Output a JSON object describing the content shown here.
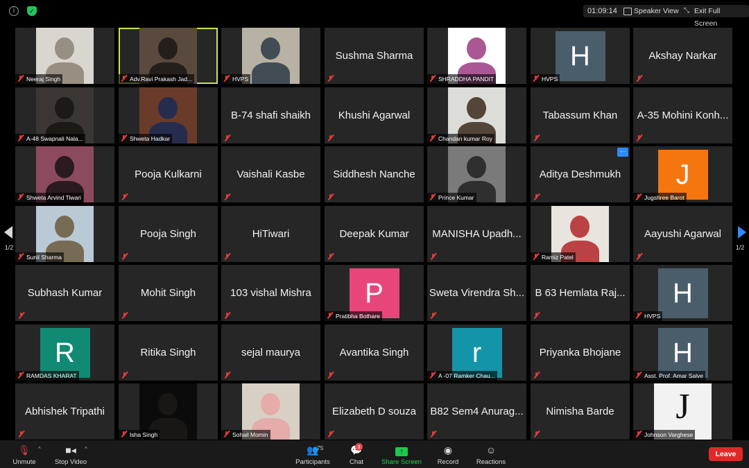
{
  "top": {
    "timer": "01:09:14",
    "speaker_view": "Speaker View",
    "exit_full_screen": "Exit Full Screen"
  },
  "pages": {
    "current": "1/2"
  },
  "tiles": [
    {
      "type": "photo",
      "label": "Neeraj Singh",
      "bg": "#d9d6d0",
      "fg": "#8c8375"
    },
    {
      "type": "photo",
      "label": "Adv.Ravi Prakash Jad...",
      "bg": "#5a4a3e",
      "fg": "#1c1816",
      "active": true
    },
    {
      "type": "photo",
      "label": "HVPS",
      "bg": "#b7b2a4",
      "fg": "#2d3a48"
    },
    {
      "type": "name",
      "name": "Sushma Sharma"
    },
    {
      "type": "photo",
      "label": "SHRADDHA PANDIT",
      "bg": "#ffffff",
      "fg": "#9c3a83"
    },
    {
      "type": "avatar",
      "label": "HVPS",
      "letter": "H",
      "color": "#4a5d6b"
    },
    {
      "type": "name",
      "name": "Akshay Narkar"
    },
    {
      "type": "photo",
      "label": "A-48 Swapnali Nala...",
      "bg": "#3b3633",
      "fg": "#191512"
    },
    {
      "type": "photo",
      "label": "Shweta Hadkar",
      "bg": "#6b3b2a",
      "fg": "#1a2a54"
    },
    {
      "type": "name",
      "name": "B-74 shafi shaikh"
    },
    {
      "type": "name",
      "name": "Khushi Agarwal"
    },
    {
      "type": "photo",
      "label": "Chandan kumar Roy",
      "bg": "#dcdcd8",
      "fg": "#3c2a20"
    },
    {
      "type": "name",
      "name": "Tabassum Khan"
    },
    {
      "type": "name",
      "name": "A-35 Mohini Konh..."
    },
    {
      "type": "photo",
      "label": "Shweta Arvind  Tiwari",
      "bg": "#8b4a5e",
      "fg": "#1a1215"
    },
    {
      "type": "name",
      "name": "Pooja Kulkarni"
    },
    {
      "type": "name",
      "name": "Vaishali Kasbe"
    },
    {
      "type": "name",
      "name": "Siddhesh Nanche"
    },
    {
      "type": "photo",
      "label": "Prince Kumar",
      "bg": "#7a7a7a",
      "fg": "#222222"
    },
    {
      "type": "name",
      "name": "Aditya Deshmukh",
      "more": true
    },
    {
      "type": "avatar",
      "label": "Jugshree Barot",
      "letter": "J",
      "color": "#f5760f"
    },
    {
      "type": "photo",
      "label": "Sunil Sharma",
      "bg": "#b9c9d6",
      "fg": "#6b5a3c"
    },
    {
      "type": "name",
      "name": "Pooja Singh"
    },
    {
      "type": "name",
      "name": "HiTiwari"
    },
    {
      "type": "name",
      "name": "Deepak Kumar"
    },
    {
      "type": "name",
      "name": "MANISHA Upadh..."
    },
    {
      "type": "photo",
      "label": "Ramiz Patel",
      "bg": "#e9e4dd",
      "fg": "#b2262a"
    },
    {
      "type": "name",
      "name": "Aayushi Agarwal"
    },
    {
      "type": "name",
      "name": "Subhash Kumar"
    },
    {
      "type": "name",
      "name": "Mohit Singh"
    },
    {
      "type": "name",
      "name": "103 vishal Mishra"
    },
    {
      "type": "avatar",
      "label": "Pratibha Bothare",
      "letter": "P",
      "color": "#e8467a"
    },
    {
      "type": "name",
      "name": "Sweta Virendra Sh..."
    },
    {
      "type": "name",
      "name": "B 63 Hemlata Raj..."
    },
    {
      "type": "avatar",
      "label": "HVPS",
      "letter": "H",
      "color": "#4a5d6b"
    },
    {
      "type": "avatar",
      "label": "RAMDAS KHARAT",
      "letter": "R",
      "color": "#108a73"
    },
    {
      "type": "name",
      "name": "Ritika Singh"
    },
    {
      "type": "name",
      "name": "sejal maurya"
    },
    {
      "type": "name",
      "name": "Avantika Singh"
    },
    {
      "type": "avatar",
      "label": "A -07 Ramker Chau...",
      "letter": "r",
      "color": "#1494a8"
    },
    {
      "type": "name",
      "name": "Priyanka Bhojane"
    },
    {
      "type": "avatar",
      "label": "Asst. Prof. Amar Salve",
      "letter": "H",
      "color": "#4a5d6b"
    },
    {
      "type": "name",
      "name": "Abhishek Tripathi"
    },
    {
      "type": "photo",
      "label": "Isha Singh",
      "bg": "#0c0b0b",
      "fg": "#1c1a18"
    },
    {
      "type": "photo",
      "label": "Sohail Momin",
      "bg": "#d8d0c4",
      "fg": "#e8a6a6"
    },
    {
      "type": "name",
      "name": "Elizabeth D souza"
    },
    {
      "type": "name",
      "name": "B82 Sem4 Anurag..."
    },
    {
      "type": "name",
      "name": "Nimisha Barde"
    },
    {
      "type": "photo",
      "label": "Johnson Varghese",
      "bg": "#f2f2f2",
      "fg": "#111111",
      "letter": "J"
    }
  ],
  "toolbar": {
    "unmute": "Unmute",
    "stop_video": "Stop Video",
    "participants": "Participants",
    "participants_count": "75",
    "chat": "Chat",
    "chat_badge": "3",
    "share_screen": "Share Screen",
    "record": "Record",
    "reactions": "Reactions",
    "leave": "Leave"
  }
}
